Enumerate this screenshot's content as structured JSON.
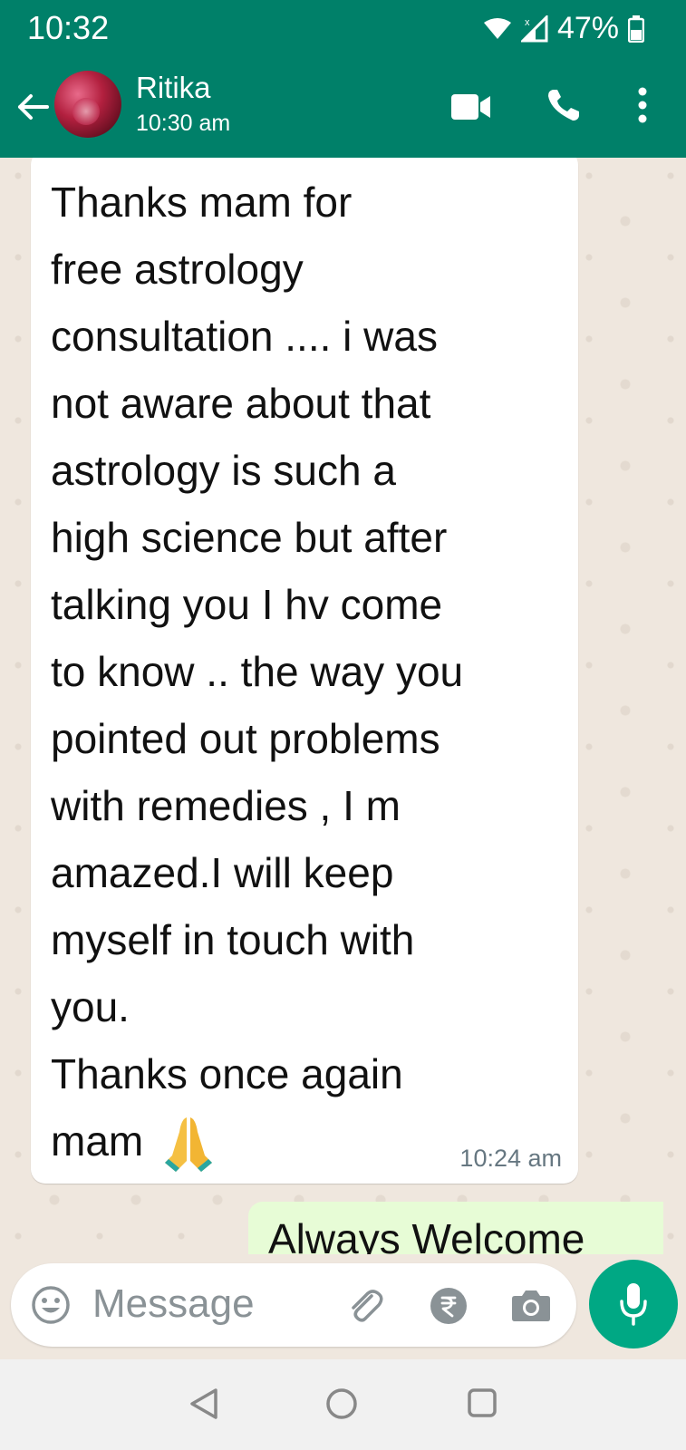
{
  "status_bar": {
    "time": "10:32",
    "battery": "47%"
  },
  "header": {
    "contact_name": "Ritika",
    "last_seen": "10:30 am"
  },
  "messages": [
    {
      "direction": "incoming",
      "text": "Thanks mam for\nfree astrology\nconsultation .... i was\nnot aware about that\nastrology is such a\nhigh science but after\ntalking you I hv come\nto know .. the way you\npointed out problems\nwith remedies , I m\namazed.I will keep\nmyself in touch with\nyou.\nThanks once again\nmam",
      "emoji": "folded-hands",
      "time": "10:24 am"
    },
    {
      "direction": "outgoing",
      "text": "Always Welcome"
    }
  ],
  "composer": {
    "placeholder": "Message"
  },
  "colors": {
    "header": "#008069",
    "incoming_bubble": "#ffffff",
    "outgoing_bubble": "#e7fcd6",
    "mic_button": "#00a884",
    "chat_bg": "#efe7de"
  },
  "icons": [
    "wifi-icon",
    "signal-icon",
    "battery-icon",
    "back-arrow-icon",
    "video-call-icon",
    "phone-icon",
    "more-vert-icon",
    "emoji-icon",
    "attach-icon",
    "rupee-payment-icon",
    "camera-icon",
    "mic-icon",
    "nav-back-icon",
    "nav-home-icon",
    "nav-recents-icon"
  ]
}
